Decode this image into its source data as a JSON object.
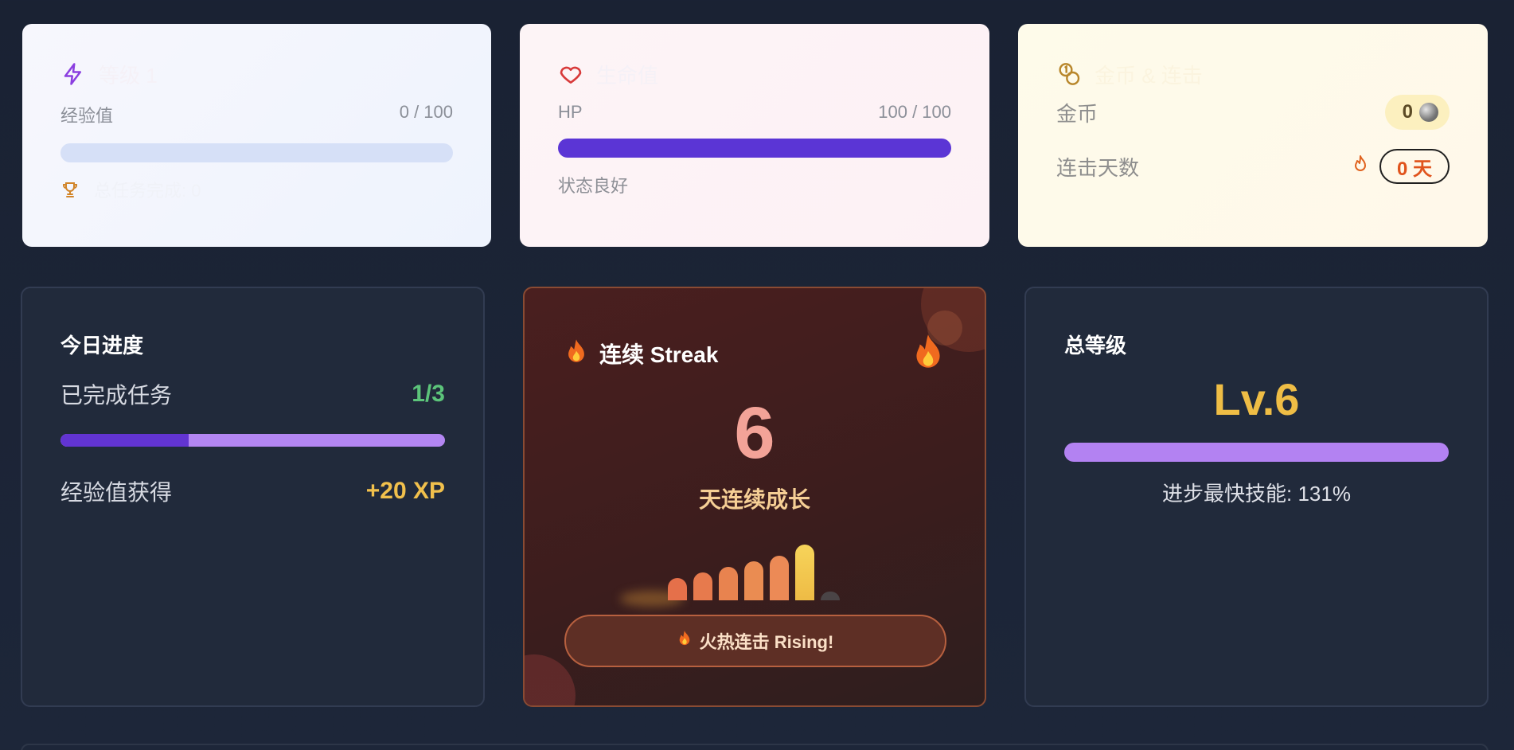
{
  "level_card": {
    "title": "等级 1",
    "xp_label": "经验值",
    "xp_value": "0 / 100",
    "xp_progress": 0,
    "completed_label": "总任务完成: 0",
    "icon": "lightning-icon",
    "trophy_icon": "trophy-icon",
    "accent": "#8b3ee0"
  },
  "hp_card": {
    "title": "生命值",
    "hp_label": "HP",
    "hp_value": "100 / 100",
    "hp_progress": 1,
    "status": "状态良好",
    "icon": "heart-icon",
    "accent": "#d83a3a"
  },
  "gold_card": {
    "title": "金币 & 连击",
    "icon": "coins-icon",
    "gold_label": "金币",
    "gold_value": "0",
    "streak_label": "连击天数",
    "streak_value": "0 天",
    "flame_icon": "flame-icon"
  },
  "today_card": {
    "title": "今日进度",
    "tasks_label": "已完成任务",
    "tasks_value": "1/3",
    "tasks_progress": 0.333,
    "xp_label": "经验值获得",
    "xp_value": "+20 XP"
  },
  "streak_card": {
    "title": "连续 Streak",
    "days": "6",
    "subtitle": "天连续成长",
    "bar_levels": [
      0.4,
      0.5,
      0.6,
      0.7,
      0.8,
      1.0,
      0.15
    ],
    "button_label": "火热连击 Rising!",
    "emoji": "🔥"
  },
  "total_card": {
    "title": "总等级",
    "level": "Lv.6",
    "fastest_skill": "进步最快技能: 131%"
  }
}
